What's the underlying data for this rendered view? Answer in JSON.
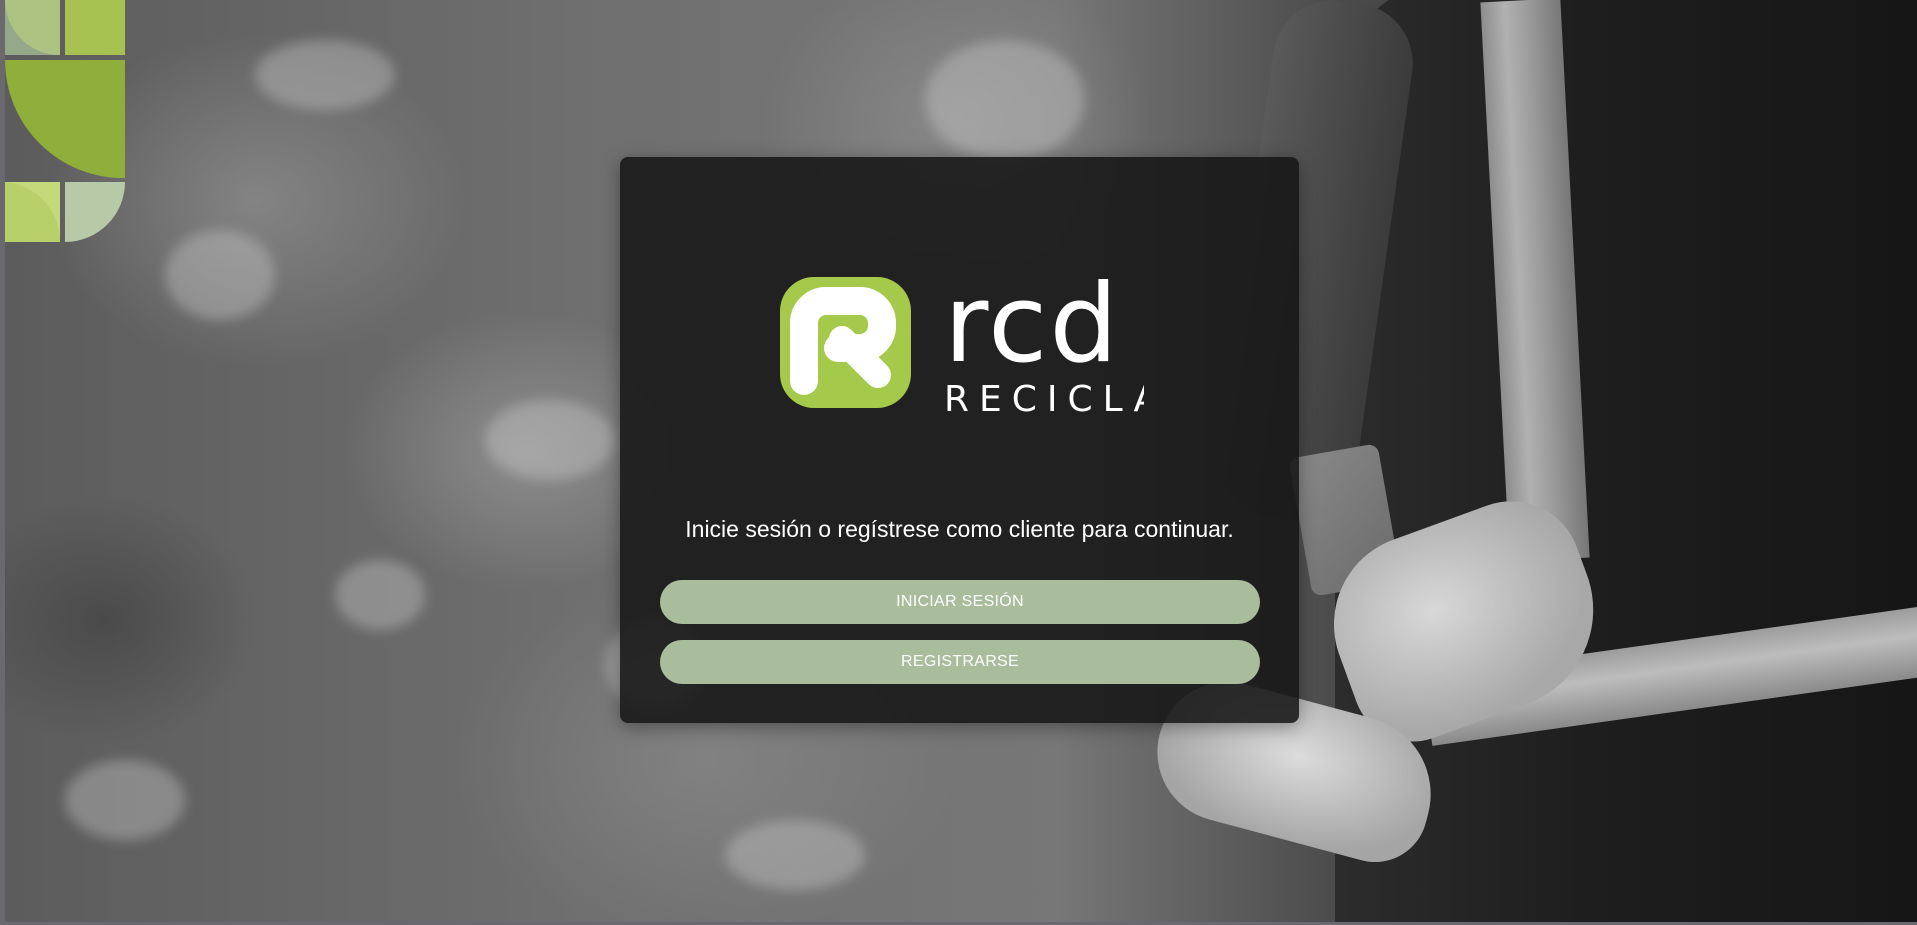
{
  "brand": {
    "logo_icon": "rcd-recycle-logo-icon",
    "wordmark": "rcd",
    "tagline": "RECICLAJE",
    "accent_color": "#a5c94b",
    "deco_colors": [
      "#8fae3a",
      "#a7c251",
      "#c3d97a",
      "#b7c9a6"
    ]
  },
  "auth": {
    "message": "Inicie sesión o regístrese como cliente para continuar.",
    "login_label": "INICIAR SESIÓN",
    "register_label": "REGISTRARSE",
    "button_color": "#a9bd9c"
  }
}
